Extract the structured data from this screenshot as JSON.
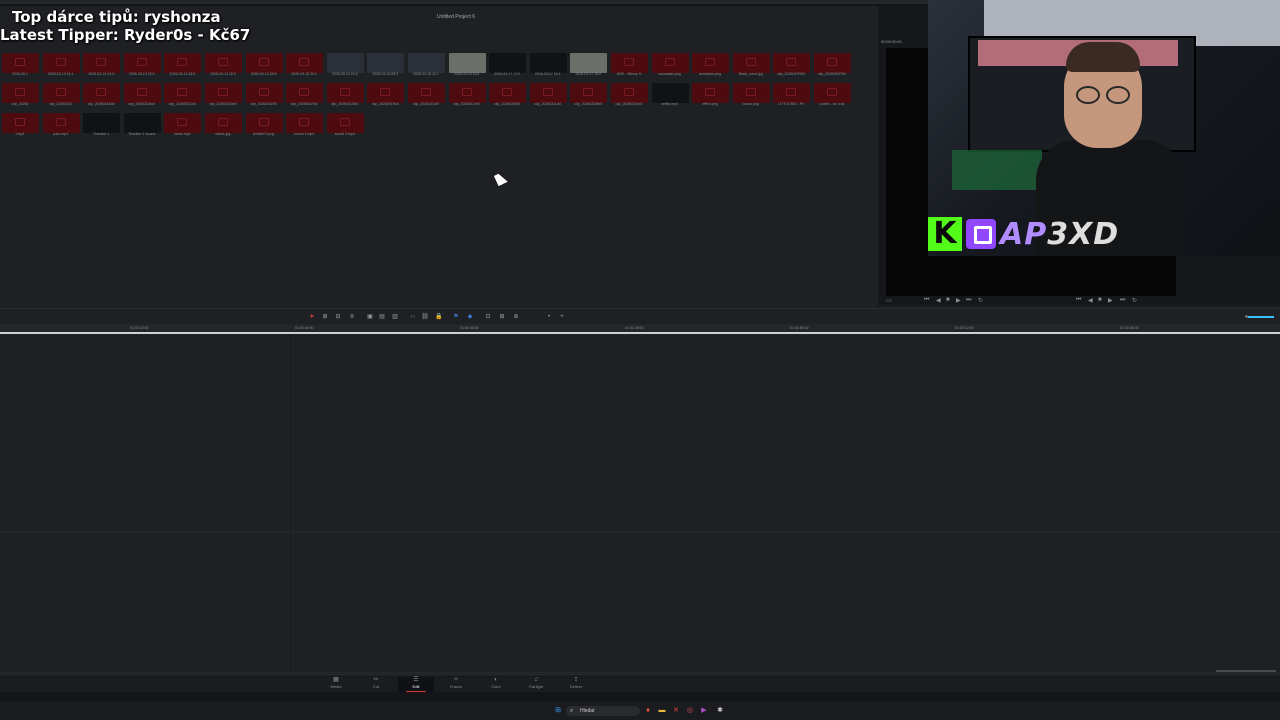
{
  "window": {
    "project_title": "Untitled Project 6"
  },
  "overlay": {
    "top_tipper": "Top dárce tipů: ryshonza",
    "latest_tipper": "Latest Tipper: Ryder0s - Kč67"
  },
  "viewer": {
    "timecode": "00:00:00:01",
    "zoom": "39%"
  },
  "stream_brand": {
    "kick_letter": "K",
    "name_part1": "AP",
    "name_part2": "3XD"
  },
  "media_pool": {
    "row1": [
      "2026-03-1",
      "2026-03-13 14:1",
      "2026-03-13 14:3",
      "2026-03-13 15:0",
      "2026-03-13 15:3",
      "2026-03-13 16:0",
      "2026-03-13 16:5",
      "2026-03-15 20:1",
      "2026-03-15 22:4",
      "2026-03-16 09:3",
      "2026-03-16 12:1",
      "2026-03-16 18:4",
      "2026-03-17 17:0",
      "2026-03-17 18:1",
      "2026-03-17 19:0",
      "1690 - Skinny H",
      "soundwav.png",
      "animation.png",
      "Black_robot.jpg",
      "clip_2026031Ff00",
      "clip_2026031Ff00"
    ],
    "row2": [
      "clip_20260",
      "clip_20260313",
      "clip_2026031Aa0",
      "clip_2026031Bc0",
      "clip_2026031Cd0",
      "clip_2026031De0",
      "clip_2026031Ef0",
      "clip_2026031Fa0",
      "clip_2026031Gb0",
      "clip_2026031Hc0",
      "clip_2026031Id0",
      "clip_2026031Je0",
      "clip_2026031Kf0",
      "clip_2026031La0",
      "clip_2026031Mb0",
      "clip_2026031Nc0",
      "netflix.mp4",
      "effect.png",
      "bonus.png",
      "LITTLE BIG - Pe",
      "Lodelo - do d ko"
    ],
    "row3": [
      "r.mp4",
      "pam.mp4",
      "Timeline 1",
      "Timeline 1 Sound",
      "name.mp4",
      "minus.jpg",
      "Untitled 2.png",
      "sound 1.mp4",
      "sound 2.mp4"
    ]
  },
  "timeline": {
    "ruler_labels": [
      "01:00:22:00",
      "01:00:44:00",
      "01:01:06:00",
      "01:01:28:00",
      "01:01:50:00",
      "01:02:12:00",
      "01:02:34:00",
      "01:02:56:00"
    ]
  },
  "pages": [
    {
      "label": "Media",
      "icon": "media-icon"
    },
    {
      "label": "Cut",
      "icon": "cut-icon"
    },
    {
      "label": "Edit",
      "icon": "edit-icon",
      "active": true
    },
    {
      "label": "Fusion",
      "icon": "fusion-icon"
    },
    {
      "label": "Color",
      "icon": "color-icon"
    },
    {
      "label": "Fairlight",
      "icon": "fairlight-icon"
    },
    {
      "label": "Deliver",
      "icon": "deliver-icon"
    }
  ],
  "taskbar": {
    "search_placeholder": "Hledat"
  },
  "colors": {
    "accent": "#d33a3a",
    "clip_red": "#4d0b10",
    "kick_green": "#53fc18",
    "twitch_purple": "#9146ff"
  }
}
